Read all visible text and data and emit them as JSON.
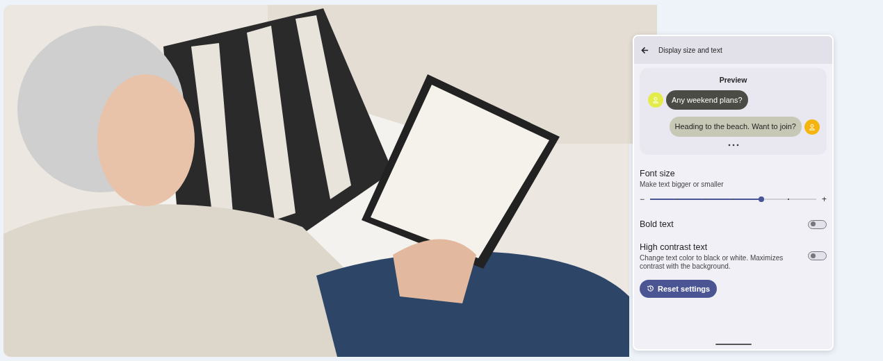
{
  "panel": {
    "title": "Display size and text",
    "preview": {
      "title": "Preview",
      "messages": [
        {
          "kind": "incoming",
          "text": "Any weekend plans?",
          "color": "#e4ec4c"
        },
        {
          "kind": "outgoing",
          "text": "Heading to the beach. Want to join?",
          "color": "#f5b511"
        }
      ]
    },
    "font_size": {
      "label": "Font size",
      "description": "Make text bigger or smaller",
      "minus": "−",
      "plus": "+",
      "level": 0.67
    },
    "toggles": [
      {
        "label": "Bold text",
        "on": false
      },
      {
        "label": "High contrast text",
        "description": "Change text color to black or white. Maximizes contrast with the background.",
        "on": false
      }
    ],
    "reset_button": "Reset settings"
  }
}
